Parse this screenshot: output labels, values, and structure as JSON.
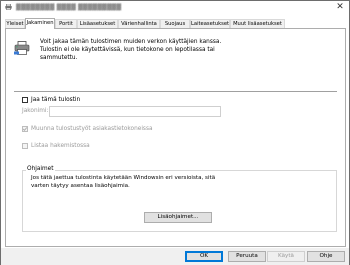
{
  "window": {
    "title": "▓▓▓▓▓▓▓▓ ▓▓▓▓ ▓▓▓▓▓▓▓▓▓",
    "close_symbol": "✕"
  },
  "tabs": [
    {
      "label": "Yleiset",
      "active": false
    },
    {
      "label": "Jakaminen",
      "active": true
    },
    {
      "label": "Portit",
      "active": false
    },
    {
      "label": "Lisäasetukset",
      "active": false
    },
    {
      "label": "Värienhallinta",
      "active": false
    },
    {
      "label": "Suojaus",
      "active": false
    },
    {
      "label": "Laiteasetukset",
      "active": false
    },
    {
      "label": "Muut lisäasetukset",
      "active": false
    }
  ],
  "sharing": {
    "intro_line1": "Voit jakaa tämän tulostimen muiden verkon käyttäjien kanssa.",
    "intro_line2": "Tulostin ei ole käytettävissä, kun tietokone on lepotilassa tai",
    "intro_line3": "sammutettu.",
    "share_checkbox_label": "Jaa tämä tulostin",
    "share_checkbox_checked": false,
    "share_name_label": "Jakonimi:",
    "share_name_value": "",
    "render_jobs_label": "Muunna tulostustyöt asiakastietokoneissa",
    "render_jobs_checked": true,
    "list_directory_label": "Listaa hakemistossa",
    "list_directory_checked": false
  },
  "drivers": {
    "title": "Ohjaimet",
    "text_line1": "Jos tätä jaettua tulostinta käytetään Windowsin eri versioista, sitä",
    "text_line2": "varten täytyy asentaa lisäohjaimia.",
    "additional_drivers_button": "Lisäohjaimet..."
  },
  "footer": {
    "ok": "OK",
    "cancel": "Peruuta",
    "apply": "Käytä",
    "help": "Ohje"
  }
}
